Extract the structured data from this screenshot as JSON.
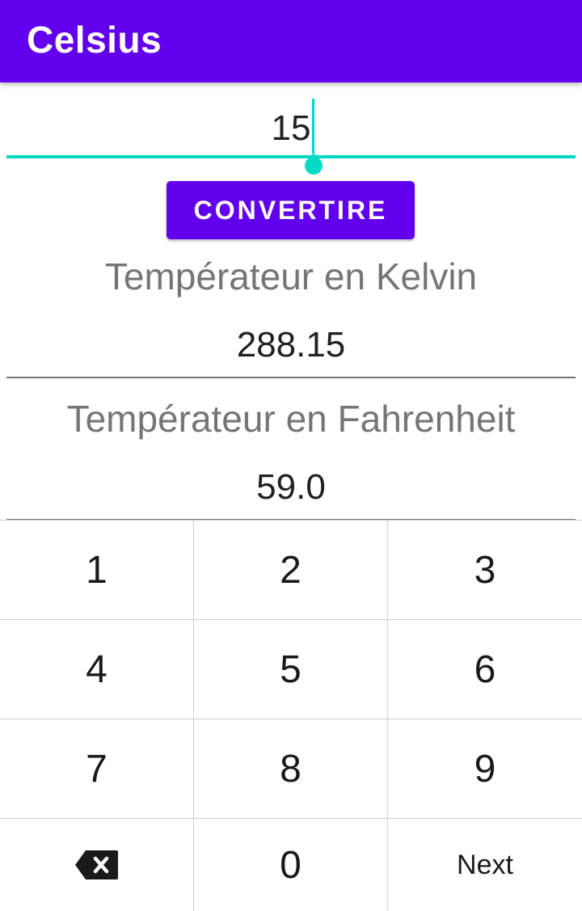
{
  "app_bar": {
    "title": "Celsius",
    "color": "#6200ee"
  },
  "celsius_input": {
    "value": "15",
    "accent_color": "#03dac5"
  },
  "convert_button": {
    "label": "CONVERTIRE"
  },
  "results": {
    "kelvin": {
      "label": "Températeur en Kelvin",
      "value": "288.15"
    },
    "fahrenheit": {
      "label": "Températeur en Fahrenheit",
      "value": "59.0"
    }
  },
  "keypad": {
    "keys": [
      {
        "name": "key-1",
        "label": "1"
      },
      {
        "name": "key-2",
        "label": "2"
      },
      {
        "name": "key-3",
        "label": "3"
      },
      {
        "name": "key-4",
        "label": "4"
      },
      {
        "name": "key-5",
        "label": "5"
      },
      {
        "name": "key-6",
        "label": "6"
      },
      {
        "name": "key-7",
        "label": "7"
      },
      {
        "name": "key-8",
        "label": "8"
      },
      {
        "name": "key-9",
        "label": "9"
      },
      {
        "name": "key-backspace",
        "label": "",
        "icon": "backspace-icon"
      },
      {
        "name": "key-0",
        "label": "0"
      },
      {
        "name": "key-next",
        "label": "Next"
      }
    ]
  }
}
